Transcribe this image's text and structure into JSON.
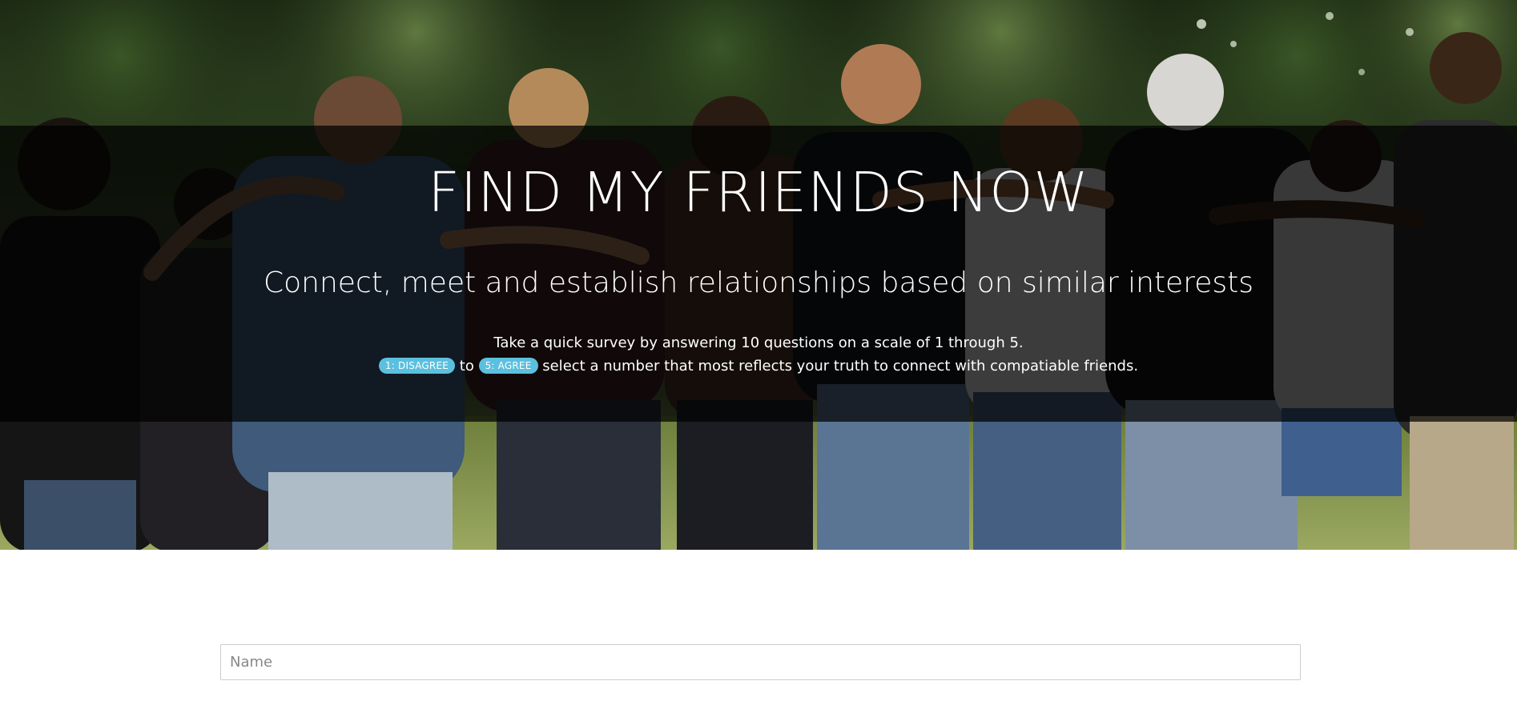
{
  "hero": {
    "title": "FIND MY FRIENDS NOW",
    "subtitle": "Connect, meet and establish relationships based on similar interests",
    "info_line1": "Take a quick survey by answering 10 questions on a scale of 1 through 5.",
    "badge_disagree": "1: DISAGREE",
    "connector": "to",
    "badge_agree": "5: AGREE",
    "info_line2_tail": "select a number that most reflects your truth to connect with compatiable friends.",
    "image_icon": "group-of-friends-photo"
  },
  "form": {
    "name_placeholder": "Name",
    "name_value": ""
  },
  "colors": {
    "badge": "#5bc0de",
    "band_overlay": "rgba(0,0,0,0.72)",
    "text_on_band": "#ffffff",
    "input_border": "#cccccc"
  }
}
